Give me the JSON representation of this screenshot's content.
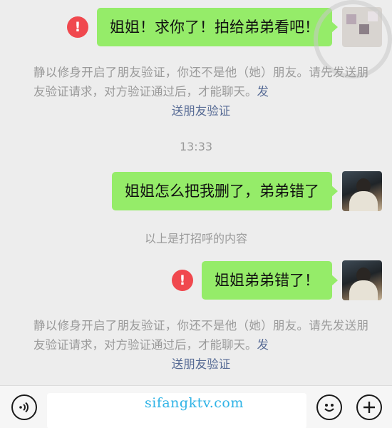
{
  "messages": [
    {
      "text": "姐姐！求你了！拍给弟弟看吧！",
      "failed": true
    },
    {
      "text": "姐姐怎么把我删了，弟弟错了",
      "failed": false
    },
    {
      "text": "姐姐弟弟错了！",
      "failed": true
    }
  ],
  "error_icon_glyph": "!",
  "notice": {
    "line1": "静以修身开启了朋友验证，你还不是他（她）朋友。请先发送朋友验证请求，对方验证通过后，才能聊天。",
    "link_prefix": "发",
    "link": "送朋友验证"
  },
  "timestamp": "13:33",
  "greeting_note": "以上是打招呼的内容",
  "watermark": "sifangktv.com",
  "colors": {
    "background": "#ededed",
    "bubble": "#95ec69",
    "error": "#f0484e",
    "link": "#576b95",
    "system_text": "#9a9a9a",
    "watermark": "#2fb3e6"
  },
  "icons": {
    "voice": "voice-icon",
    "emoji": "emoji-icon",
    "plus": "plus-icon",
    "error": "error-icon"
  }
}
